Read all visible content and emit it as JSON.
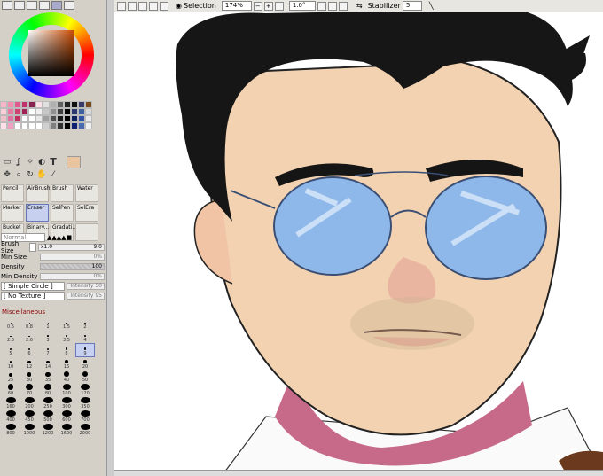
{
  "toolbar": {
    "selection_label": "Selection",
    "zoom": "174%",
    "rotation": "1.0°",
    "stabilizer_label": "Stabilizer",
    "stabilizer_value": "5"
  },
  "brushes": [
    {
      "label": "Pencil"
    },
    {
      "label": "AirBrush"
    },
    {
      "label": "Brush"
    },
    {
      "label": "Water"
    },
    {
      "label": "Marker"
    },
    {
      "label": "Eraser"
    },
    {
      "label": "SelPen"
    },
    {
      "label": "SelEra"
    },
    {
      "label": "Bucket"
    },
    {
      "label": "Binary..."
    },
    {
      "label": "Gradati..."
    },
    {
      "label": ""
    }
  ],
  "props": {
    "blend_mode": "Normal",
    "brush_size_label": "Brush Size",
    "brush_size_mult": "x1.0",
    "brush_size_value": "9.0",
    "min_size_label": "Min Size",
    "min_size_value": "0%",
    "density_label": "Density",
    "density_value": "100",
    "min_density_label": "Min Density",
    "min_density_value": "0%",
    "shape": "[ Simple Circle ]",
    "shape_intensity": "Intensity 50",
    "texture": "[ No Texture ]",
    "texture_intensity": "Intensity 95",
    "misc_label": "Miscellaneous"
  },
  "sizes": [
    "0.6",
    "0.8",
    "1",
    "1.5",
    "2",
    "2.3",
    "2.6",
    "3",
    "3.5",
    "4",
    "5",
    "6",
    "7",
    "8",
    "9",
    "10",
    "12",
    "14",
    "16",
    "20",
    "25",
    "30",
    "35",
    "40",
    "50",
    "60",
    "70",
    "80",
    "100",
    "120",
    "160",
    "200",
    "250",
    "300",
    "350",
    "400",
    "450",
    "500",
    "600",
    "700",
    "800",
    "1000",
    "1200",
    "1600",
    "2000"
  ],
  "selected_size": "9",
  "colors": {
    "current": "#e8c4a0",
    "accent": "#6677bb"
  }
}
